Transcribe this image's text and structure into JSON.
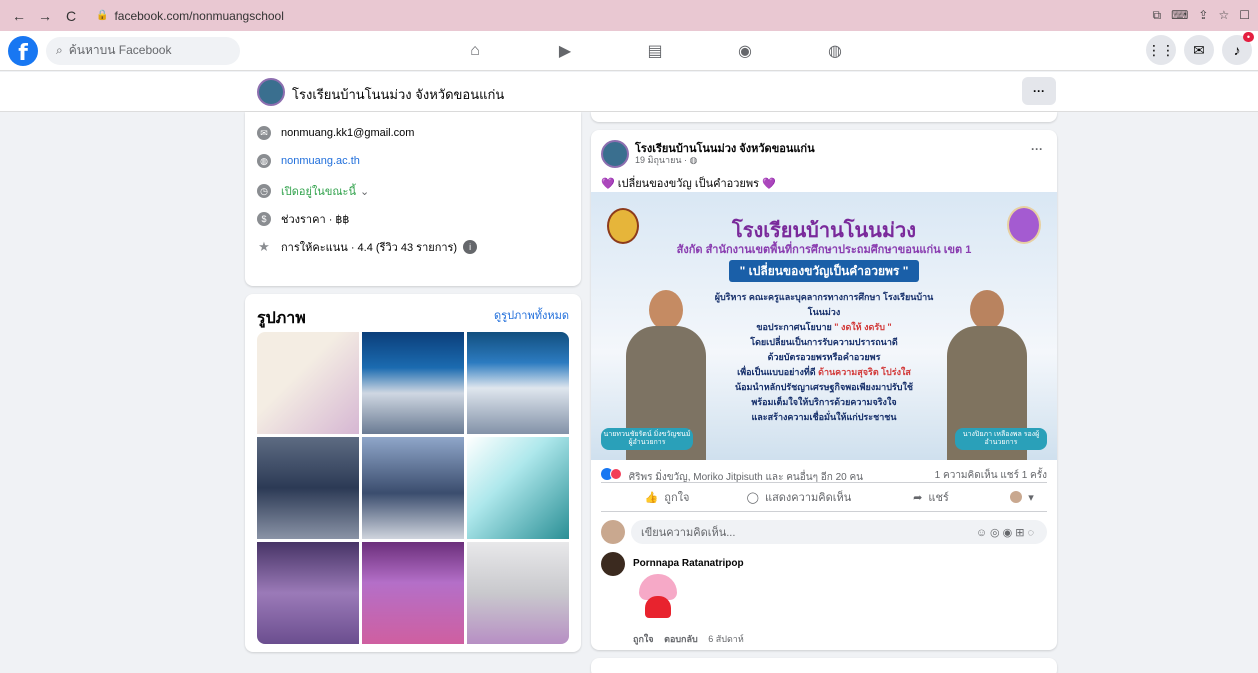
{
  "browser": {
    "url": "facebook.com/nonmuangschool",
    "nav_back": "←",
    "nav_forward": "→",
    "nav_reload": "C"
  },
  "fb_nav": {
    "logo": "f",
    "search_placeholder": "ค้นหาบน Facebook"
  },
  "page": {
    "name": "โรงเรียนบ้านโนนม่วง จังหวัดขอนแก่น",
    "more": "···"
  },
  "intro": {
    "email": "nonmuang.kk1@gmail.com",
    "website": "nonmuang.ac.th",
    "open_status": "เปิดอยู่ในขณะนี้",
    "price_range": "ช่วงราคา · ฿฿",
    "rating": "การให้คะแนน · 4.4 (รีวิว 43 รายการ)"
  },
  "photos": {
    "title": "รูปภาพ",
    "see_all": "ดูรูปภาพทั้งหมด"
  },
  "post": {
    "author": "โรงเรียนบ้านโนนม่วง จังหวัดขอนแก่น",
    "date": "19 มิถุนายน · ◍",
    "text": "💜 เปลี่ยนของขวัญ เป็นคำอวยพร 💜",
    "banner": {
      "title": "โรงเรียนบ้านโนนม่วง",
      "subtitle": "สังกัด สำนักงานเขตพื้นที่การศึกษาประถมศึกษาขอนแก่น เขต 1",
      "box": "\" เปลี่ยนของขวัญเป็นคำอวยพร \"",
      "line1": "ผู้บริหาร คณะครูและบุคลากรทางการศึกษา โรงเรียนบ้านโนนม่วง",
      "line2a": "ขอประกาศนโยบาย ",
      "line2b": "\" งดให้ งดรับ \"",
      "line3": "โดยเปลี่ยนเป็นการรับความปรารถนาดี",
      "line4": "ด้วยบัตรอวยพรหรือคำอวยพร",
      "line5a": "เพื่อเป็นแบบอย่างที่ดี ",
      "line5b": "ด้านความสุจริต โปร่งใส",
      "line6": "น้อมนำหลักปรัชญาเศรษฐกิจพอเพียงมาปรับใช้",
      "line7": "พร้อมเต็มใจให้บริการด้วยความจริงใจ",
      "line8": "และสร้างความเชื่อมั่นให้แก่ประชาชน",
      "tag_left": "นายทวนชัยรัตน์ มิ่งขวัญชนม์ ผู้อำนวยการ",
      "tag_right": "นางปิยภา เหลืองพล รองผู้อำนวยการ"
    },
    "reactions": "ศิริพร มิ่งขวัญ, Moriko Jitpisuth และ คนอื่นๆ อีก 20 คน",
    "counts": "1 ความคิดเห็น  แชร์ 1 ครั้ง",
    "like_label": "ถูกใจ",
    "comment_label": "แสดงความคิดเห็น",
    "share_label": "แชร์",
    "comment_placeholder": "เขียนความคิดเห็น...",
    "comment_author": "Pornnapa Ratanatripop",
    "comment_like": "ถูกใจ",
    "comment_reply": "ตอบกลับ",
    "comment_time": "6 สัปดาห์"
  },
  "colors": {
    "accent": "#1877f2",
    "link": "#216fdb",
    "browser_bar": "#e9c8d2"
  }
}
